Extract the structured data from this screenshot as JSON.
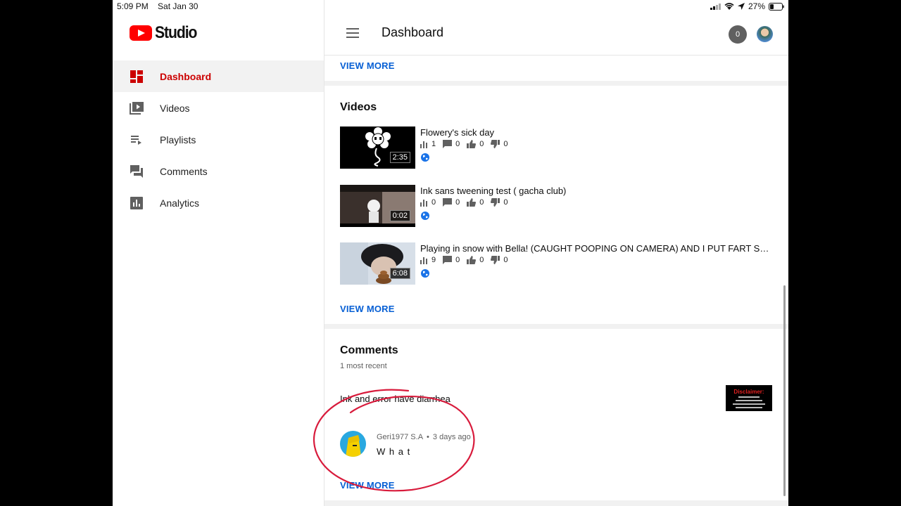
{
  "status_bar": {
    "time": "5:09 PM",
    "date": "Sat Jan 30",
    "battery": "27%"
  },
  "brand": {
    "name": "Studio"
  },
  "sidebar": {
    "items": [
      {
        "label": "Dashboard",
        "icon": "dashboard-icon",
        "active": true
      },
      {
        "label": "Videos",
        "icon": "videos-icon"
      },
      {
        "label": "Playlists",
        "icon": "playlists-icon"
      },
      {
        "label": "Comments",
        "icon": "comments-icon"
      },
      {
        "label": "Analytics",
        "icon": "analytics-icon"
      }
    ]
  },
  "header": {
    "title": "Dashboard",
    "notification_count": "0"
  },
  "top_card": {
    "view_more": "VIEW MORE"
  },
  "videos": {
    "title": "Videos",
    "view_more": "VIEW MORE",
    "items": [
      {
        "title": "Flowery's sick day",
        "duration": "2:35",
        "views": "1",
        "comments": "0",
        "likes": "0",
        "dislikes": "0"
      },
      {
        "title": "Ink sans tweening test ( gacha club)",
        "duration": "0:02",
        "views": "0",
        "comments": "0",
        "likes": "0",
        "dislikes": "0"
      },
      {
        "title": "Playing in snow with Bella! (CAUGHT POOPING ON CAMERA) AND I PUT FART SOUN…",
        "duration": "6:08",
        "views": "9",
        "comments": "0",
        "likes": "0",
        "dislikes": "0"
      }
    ]
  },
  "comments": {
    "title": "Comments",
    "subtitle": "1 most recent",
    "video_title": "Ink and error have diarrhea",
    "thumb_heading": "Disclaimer:",
    "author": "Geri1977 S.A",
    "separator": "•",
    "time_ago": "3 days ago",
    "text": "W h a t",
    "view_more": "VIEW MORE"
  },
  "colors": {
    "accent_red": "#cc0000",
    "link_blue": "#065fd4",
    "annotation": "#d81b3c"
  }
}
